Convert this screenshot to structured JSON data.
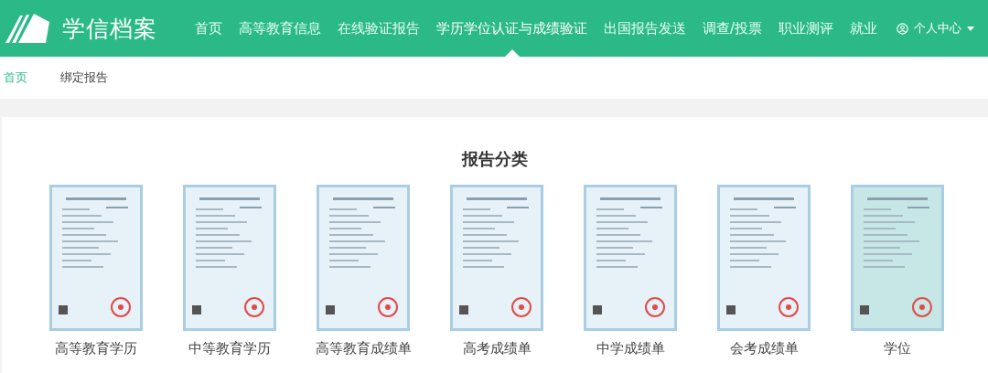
{
  "header": {
    "logo_text": "学信档案",
    "nav": [
      {
        "label": "首页",
        "selected": false
      },
      {
        "label": "高等教育信息",
        "selected": false
      },
      {
        "label": "在线验证报告",
        "selected": false
      },
      {
        "label": "学历学位认证与成绩验证",
        "selected": true
      },
      {
        "label": "出国报告发送",
        "selected": false
      },
      {
        "label": "调查/投票",
        "selected": false
      },
      {
        "label": "职业测评",
        "selected": false
      },
      {
        "label": "就业",
        "selected": false
      }
    ],
    "user_menu": {
      "label": "个人中心"
    }
  },
  "breadcrumb": [
    {
      "label": "首页",
      "selected": true
    },
    {
      "label": "绑定报告",
      "selected": false
    }
  ],
  "section": {
    "title": "报告分类",
    "reports": [
      {
        "kind": "picture",
        "label": "高等教育学历"
      },
      {
        "kind": "picture",
        "label": "中等教育学历"
      },
      {
        "kind": "picture",
        "label": "高等教育成绩单"
      },
      {
        "kind": "picture",
        "label": "高考成绩单"
      },
      {
        "kind": "picture",
        "label": "中学成绩单"
      },
      {
        "kind": "picture",
        "label": "会考成绩单"
      },
      {
        "kind": "picture",
        "label": "学位"
      }
    ]
  }
}
